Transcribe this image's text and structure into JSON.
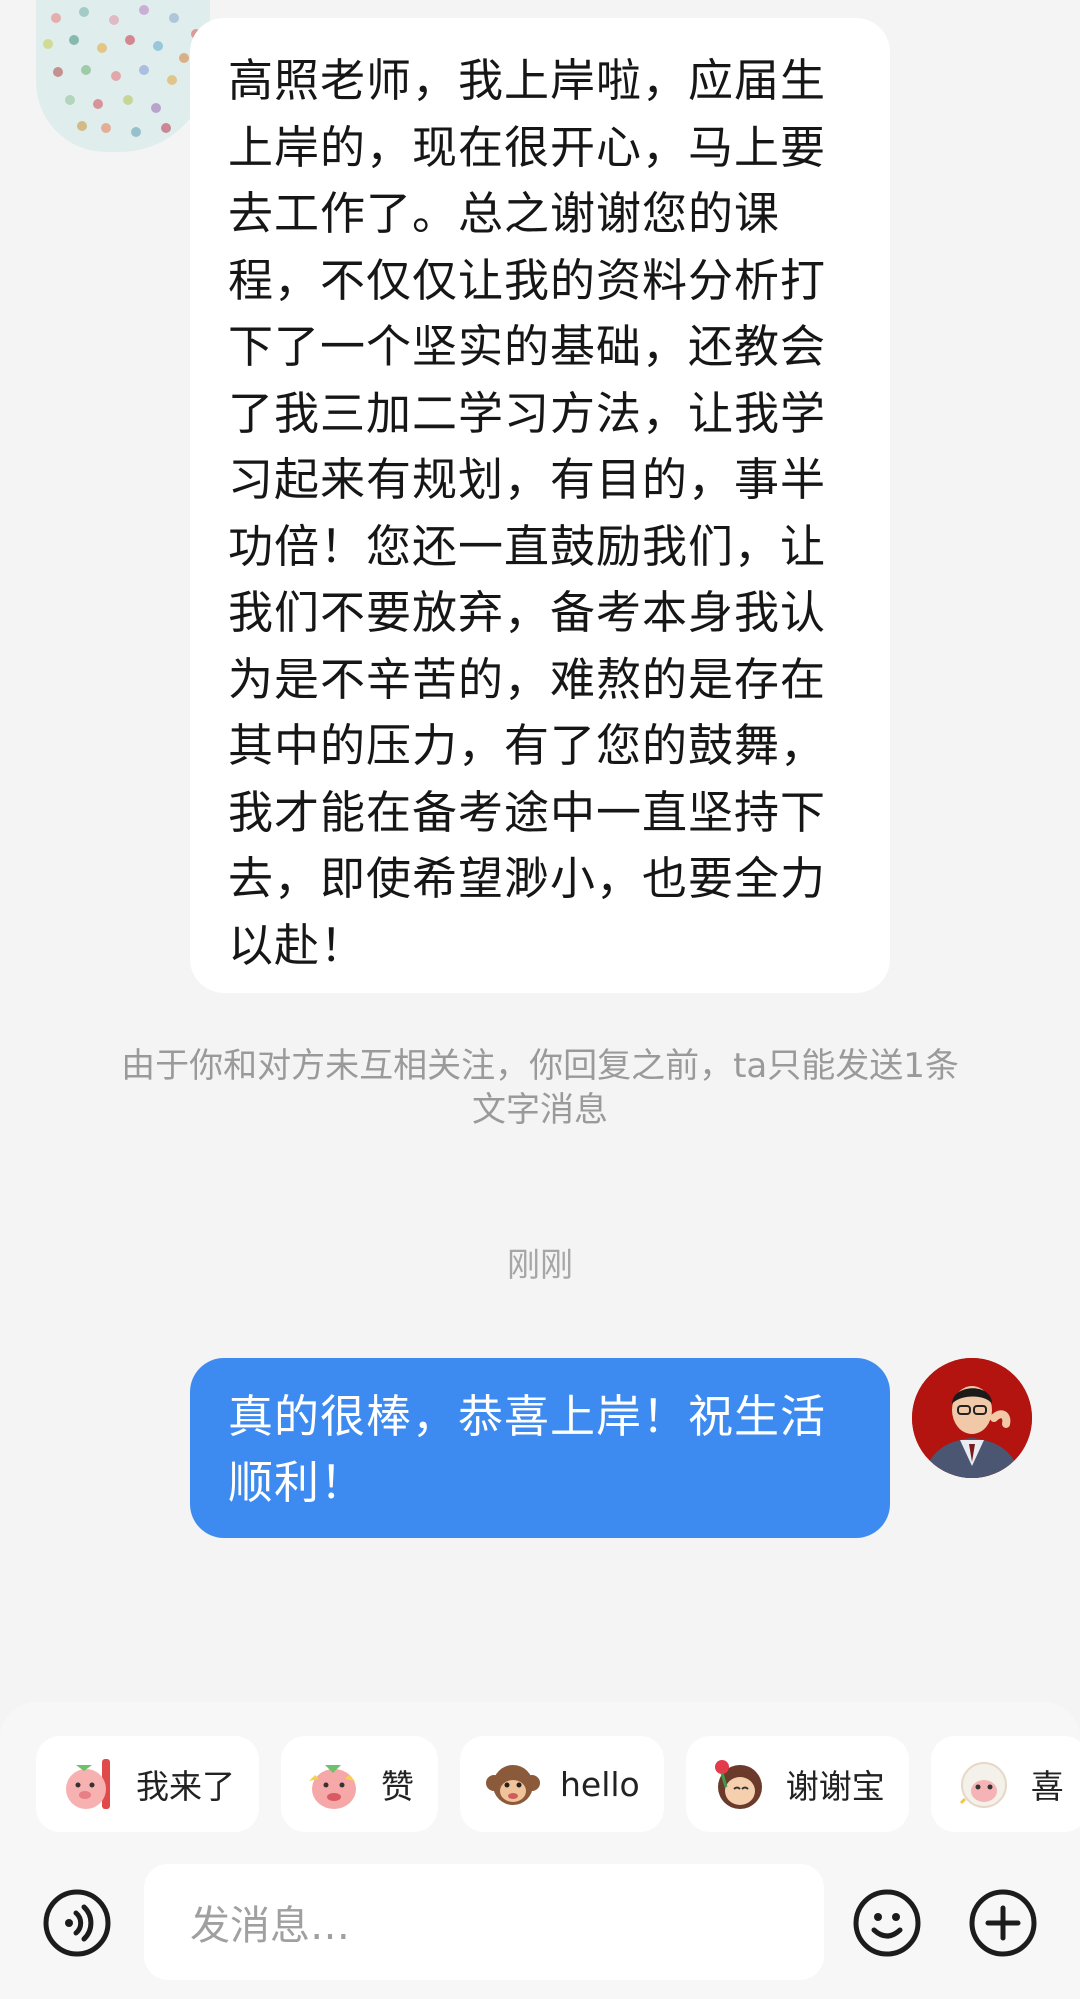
{
  "incoming_message": {
    "text": "高照老师，我上岸啦，应届生上岸的，现在很开心，马上要去工作了。总之谢谢您的课程，不仅仅让我的资料分析打下了一个坚实的基础，还教会了我三加二学习方法，让我学习起来有规划，有目的，事半功倍！您还一直鼓励我们，让我们不要放弃，备考本身我认为是不辛苦的，难熬的是存在其中的压力，有了您的鼓舞，我才能在备考途中一直坚持下去，即使希望渺小，也要全力以赴！"
  },
  "notice": {
    "text": "由于你和对方未互相关注，你回复之前，ta只能发送1条文字消息"
  },
  "timestamp": "刚刚",
  "outgoing_message": {
    "text": "真的很棒，恭喜上岸！祝生活顺利！"
  },
  "quick_stickers": [
    {
      "label": "我来了",
      "icon": "sticker-pig-waving-icon"
    },
    {
      "label": "赞",
      "icon": "sticker-pig-thumbs-up-icon"
    },
    {
      "label": "hello",
      "icon": "sticker-monkey-hello-icon"
    },
    {
      "label": "谢谢宝",
      "icon": "sticker-girl-rose-icon"
    },
    {
      "label": "喜",
      "icon": "sticker-sheep-icon"
    }
  ],
  "composer": {
    "placeholder": "发消息…",
    "voice_icon": "voice-icon",
    "emoji_icon": "emoji-icon",
    "plus_icon": "plus-icon"
  },
  "colors": {
    "background": "#f4f4f4",
    "incoming_bubble": "#ffffff",
    "outgoing_bubble": "#3d8bf0",
    "muted_text": "#9a9a9a"
  }
}
